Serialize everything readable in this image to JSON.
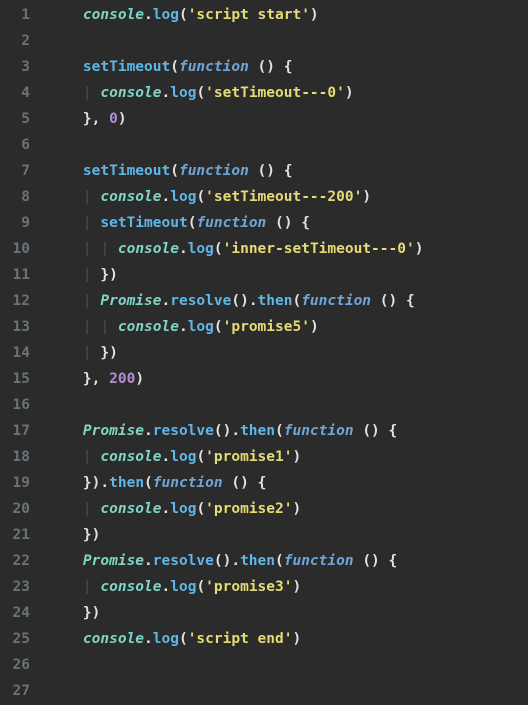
{
  "editor": {
    "line_count": 27,
    "indent_unit": "  ",
    "tokens": [
      [
        {
          "c": "sp",
          "t": "    "
        },
        {
          "c": "obj",
          "t": "console"
        },
        {
          "c": "dot",
          "t": "."
        },
        {
          "c": "meth",
          "t": "log"
        },
        {
          "c": "punc",
          "t": "("
        },
        {
          "c": "str",
          "t": "'script start'"
        },
        {
          "c": "punc",
          "t": ")"
        }
      ],
      [],
      [
        {
          "c": "sp",
          "t": "    "
        },
        {
          "c": "meth",
          "t": "setTimeout"
        },
        {
          "c": "punc",
          "t": "("
        },
        {
          "c": "kw",
          "t": "function"
        },
        {
          "c": "sp",
          "t": " "
        },
        {
          "c": "punc",
          "t": "()"
        },
        {
          "c": "sp",
          "t": " "
        },
        {
          "c": "brace",
          "t": "{"
        }
      ],
      [
        {
          "c": "sp",
          "t": "    "
        },
        {
          "c": "guide",
          "t": "| "
        },
        {
          "c": "obj",
          "t": "console"
        },
        {
          "c": "dot",
          "t": "."
        },
        {
          "c": "meth",
          "t": "log"
        },
        {
          "c": "punc",
          "t": "("
        },
        {
          "c": "str",
          "t": "'setTimeout---0'"
        },
        {
          "c": "punc",
          "t": ")"
        }
      ],
      [
        {
          "c": "sp",
          "t": "    "
        },
        {
          "c": "brace",
          "t": "}"
        },
        {
          "c": "punc",
          "t": ", "
        },
        {
          "c": "num",
          "t": "0"
        },
        {
          "c": "punc",
          "t": ")"
        }
      ],
      [],
      [
        {
          "c": "sp",
          "t": "    "
        },
        {
          "c": "meth",
          "t": "setTimeout"
        },
        {
          "c": "punc",
          "t": "("
        },
        {
          "c": "kw",
          "t": "function"
        },
        {
          "c": "sp",
          "t": " "
        },
        {
          "c": "punc",
          "t": "()"
        },
        {
          "c": "sp",
          "t": " "
        },
        {
          "c": "brace",
          "t": "{"
        }
      ],
      [
        {
          "c": "sp",
          "t": "    "
        },
        {
          "c": "guide",
          "t": "| "
        },
        {
          "c": "obj",
          "t": "console"
        },
        {
          "c": "dot",
          "t": "."
        },
        {
          "c": "meth",
          "t": "log"
        },
        {
          "c": "punc",
          "t": "("
        },
        {
          "c": "str",
          "t": "'setTimeout---200'"
        },
        {
          "c": "punc",
          "t": ")"
        }
      ],
      [
        {
          "c": "sp",
          "t": "    "
        },
        {
          "c": "guide",
          "t": "| "
        },
        {
          "c": "meth",
          "t": "setTimeout"
        },
        {
          "c": "punc",
          "t": "("
        },
        {
          "c": "kw",
          "t": "function"
        },
        {
          "c": "sp",
          "t": " "
        },
        {
          "c": "punc",
          "t": "()"
        },
        {
          "c": "sp",
          "t": " "
        },
        {
          "c": "brace",
          "t": "{"
        }
      ],
      [
        {
          "c": "sp",
          "t": "    "
        },
        {
          "c": "guide",
          "t": "| "
        },
        {
          "c": "guide",
          "t": "| "
        },
        {
          "c": "obj",
          "t": "console"
        },
        {
          "c": "dot",
          "t": "."
        },
        {
          "c": "meth",
          "t": "log"
        },
        {
          "c": "punc",
          "t": "("
        },
        {
          "c": "str",
          "t": "'inner-setTimeout---0'"
        },
        {
          "c": "punc",
          "t": ")"
        }
      ],
      [
        {
          "c": "sp",
          "t": "    "
        },
        {
          "c": "guide",
          "t": "| "
        },
        {
          "c": "brace",
          "t": "}"
        },
        {
          "c": "punc",
          "t": ")"
        }
      ],
      [
        {
          "c": "sp",
          "t": "    "
        },
        {
          "c": "guide",
          "t": "| "
        },
        {
          "c": "obj",
          "t": "Promise"
        },
        {
          "c": "dot",
          "t": "."
        },
        {
          "c": "meth",
          "t": "resolve"
        },
        {
          "c": "punc",
          "t": "()"
        },
        {
          "c": "dot",
          "t": "."
        },
        {
          "c": "meth",
          "t": "then"
        },
        {
          "c": "punc",
          "t": "("
        },
        {
          "c": "kw",
          "t": "function"
        },
        {
          "c": "sp",
          "t": " "
        },
        {
          "c": "punc",
          "t": "()"
        },
        {
          "c": "sp",
          "t": " "
        },
        {
          "c": "brace",
          "t": "{"
        }
      ],
      [
        {
          "c": "sp",
          "t": "    "
        },
        {
          "c": "guide",
          "t": "| "
        },
        {
          "c": "guide",
          "t": "| "
        },
        {
          "c": "obj",
          "t": "console"
        },
        {
          "c": "dot",
          "t": "."
        },
        {
          "c": "meth",
          "t": "log"
        },
        {
          "c": "punc",
          "t": "("
        },
        {
          "c": "str",
          "t": "'promise5'"
        },
        {
          "c": "punc",
          "t": ")"
        }
      ],
      [
        {
          "c": "sp",
          "t": "    "
        },
        {
          "c": "guide",
          "t": "| "
        },
        {
          "c": "brace",
          "t": "}"
        },
        {
          "c": "punc",
          "t": ")"
        }
      ],
      [
        {
          "c": "sp",
          "t": "    "
        },
        {
          "c": "brace",
          "t": "}"
        },
        {
          "c": "punc",
          "t": ", "
        },
        {
          "c": "num",
          "t": "200"
        },
        {
          "c": "punc",
          "t": ")"
        }
      ],
      [],
      [
        {
          "c": "sp",
          "t": "    "
        },
        {
          "c": "obj",
          "t": "Promise"
        },
        {
          "c": "dot",
          "t": "."
        },
        {
          "c": "meth",
          "t": "resolve"
        },
        {
          "c": "punc",
          "t": "()"
        },
        {
          "c": "dot",
          "t": "."
        },
        {
          "c": "meth",
          "t": "then"
        },
        {
          "c": "punc",
          "t": "("
        },
        {
          "c": "kw",
          "t": "function"
        },
        {
          "c": "sp",
          "t": " "
        },
        {
          "c": "punc",
          "t": "()"
        },
        {
          "c": "sp",
          "t": " "
        },
        {
          "c": "brace",
          "t": "{"
        }
      ],
      [
        {
          "c": "sp",
          "t": "    "
        },
        {
          "c": "guide",
          "t": "| "
        },
        {
          "c": "obj",
          "t": "console"
        },
        {
          "c": "dot",
          "t": "."
        },
        {
          "c": "meth",
          "t": "log"
        },
        {
          "c": "punc",
          "t": "("
        },
        {
          "c": "str",
          "t": "'promise1'"
        },
        {
          "c": "punc",
          "t": ")"
        }
      ],
      [
        {
          "c": "sp",
          "t": "    "
        },
        {
          "c": "brace",
          "t": "}"
        },
        {
          "c": "punc",
          "t": ")"
        },
        {
          "c": "dot",
          "t": "."
        },
        {
          "c": "meth",
          "t": "then"
        },
        {
          "c": "punc",
          "t": "("
        },
        {
          "c": "kw",
          "t": "function"
        },
        {
          "c": "sp",
          "t": " "
        },
        {
          "c": "punc",
          "t": "()"
        },
        {
          "c": "sp",
          "t": " "
        },
        {
          "c": "brace",
          "t": "{"
        }
      ],
      [
        {
          "c": "sp",
          "t": "    "
        },
        {
          "c": "guide",
          "t": "| "
        },
        {
          "c": "obj",
          "t": "console"
        },
        {
          "c": "dot",
          "t": "."
        },
        {
          "c": "meth",
          "t": "log"
        },
        {
          "c": "punc",
          "t": "("
        },
        {
          "c": "str",
          "t": "'promise2'"
        },
        {
          "c": "punc",
          "t": ")"
        }
      ],
      [
        {
          "c": "sp",
          "t": "    "
        },
        {
          "c": "brace",
          "t": "}"
        },
        {
          "c": "punc",
          "t": ")"
        }
      ],
      [
        {
          "c": "sp",
          "t": "    "
        },
        {
          "c": "obj",
          "t": "Promise"
        },
        {
          "c": "dot",
          "t": "."
        },
        {
          "c": "meth",
          "t": "resolve"
        },
        {
          "c": "punc",
          "t": "()"
        },
        {
          "c": "dot",
          "t": "."
        },
        {
          "c": "meth",
          "t": "then"
        },
        {
          "c": "punc",
          "t": "("
        },
        {
          "c": "kw",
          "t": "function"
        },
        {
          "c": "sp",
          "t": " "
        },
        {
          "c": "punc",
          "t": "()"
        },
        {
          "c": "sp",
          "t": " "
        },
        {
          "c": "brace",
          "t": "{"
        }
      ],
      [
        {
          "c": "sp",
          "t": "    "
        },
        {
          "c": "guide",
          "t": "| "
        },
        {
          "c": "obj",
          "t": "console"
        },
        {
          "c": "dot",
          "t": "."
        },
        {
          "c": "meth",
          "t": "log"
        },
        {
          "c": "punc",
          "t": "("
        },
        {
          "c": "str",
          "t": "'promise3'"
        },
        {
          "c": "punc",
          "t": ")"
        }
      ],
      [
        {
          "c": "sp",
          "t": "    "
        },
        {
          "c": "brace",
          "t": "}"
        },
        {
          "c": "punc",
          "t": ")"
        }
      ],
      [
        {
          "c": "sp",
          "t": "    "
        },
        {
          "c": "obj",
          "t": "console"
        },
        {
          "c": "dot",
          "t": "."
        },
        {
          "c": "meth",
          "t": "log"
        },
        {
          "c": "punc",
          "t": "("
        },
        {
          "c": "str",
          "t": "'script end'"
        },
        {
          "c": "punc",
          "t": ")"
        }
      ],
      [],
      []
    ]
  }
}
